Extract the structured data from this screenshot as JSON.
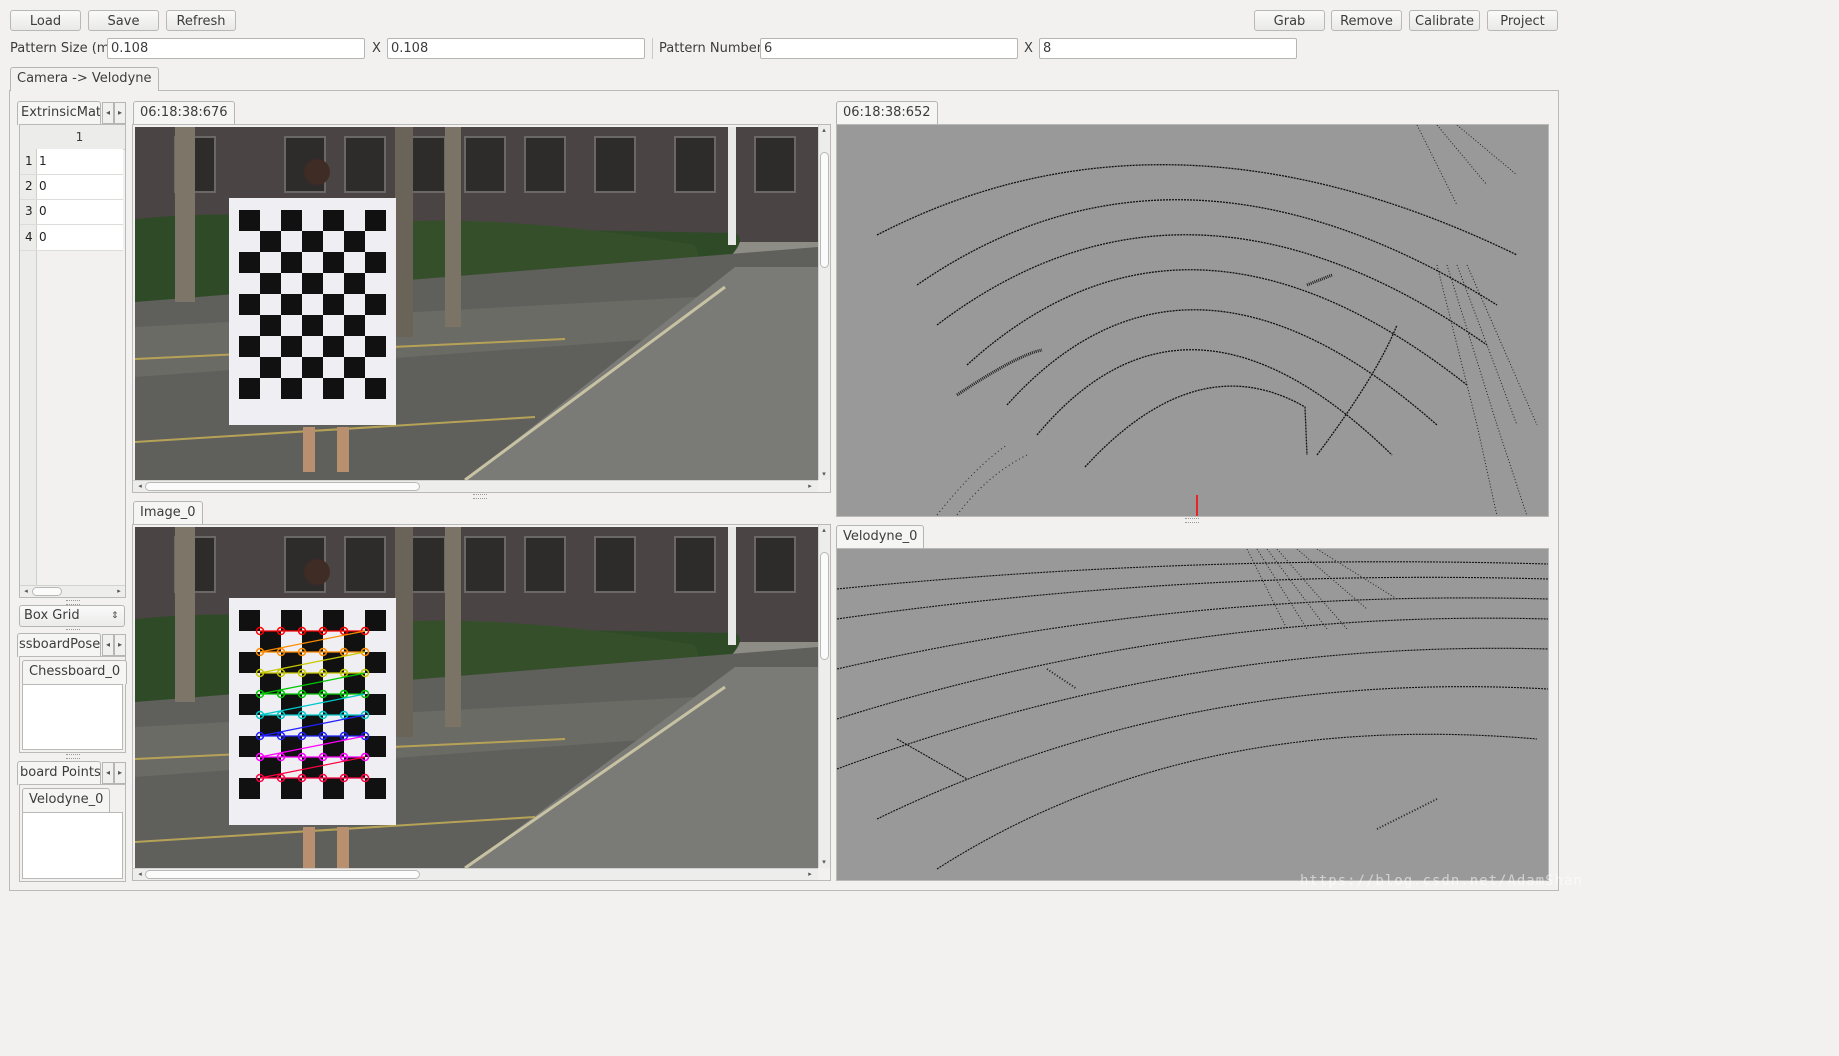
{
  "toolbar": {
    "load_label": "Load",
    "save_label": "Save",
    "refresh_label": "Refresh",
    "grab_label": "Grab",
    "remove_label": "Remove",
    "calibrate_label": "Calibrate",
    "project_label": "Project"
  },
  "params": {
    "pattern_size_label": "Pattern Size (m)",
    "pattern_size_x": "0.108",
    "pattern_size_y": "0.108",
    "x_sep": "X",
    "pattern_number_label": "Pattern Number",
    "pattern_number_x": "6",
    "pattern_number_y": "8"
  },
  "main_tab": {
    "label": "Camera -> Velodyne"
  },
  "left_panel": {
    "extrinsic_tab": "ExtrinsicMat",
    "table": {
      "column_header": "1",
      "rows": [
        {
          "index": "1",
          "value": "1"
        },
        {
          "index": "2",
          "value": "0"
        },
        {
          "index": "3",
          "value": "0"
        },
        {
          "index": "4",
          "value": "0"
        }
      ]
    },
    "view_mode": {
      "selected": "Box Grid"
    },
    "chessboard_pose_tab": "ssboardPose",
    "chessboard_item_tab": "Chessboard_0",
    "board_points_tab": "board Points",
    "velodyne_item_tab": "Velodyne_0"
  },
  "camera_top": {
    "timestamp": "06:18:38:676"
  },
  "camera_bottom": {
    "tab": "Image_0"
  },
  "velodyne_top": {
    "timestamp": "06:18:38:652"
  },
  "velodyne_bottom": {
    "tab": "Velodyne_0"
  },
  "watermark": "https://blog.csdn.net/AdamShan",
  "icons": {
    "scroll_left": "◂",
    "scroll_right": "▸",
    "scroll_up": "▴",
    "scroll_down": "▾",
    "spin": "⇕"
  },
  "colors": {
    "lidar_bg": "#999999",
    "checker_rows": [
      "#ff0000",
      "#ff8c00",
      "#c8c800",
      "#00c800",
      "#00c8c8",
      "#2020ff",
      "#ff00ff",
      "#ff0040"
    ]
  }
}
